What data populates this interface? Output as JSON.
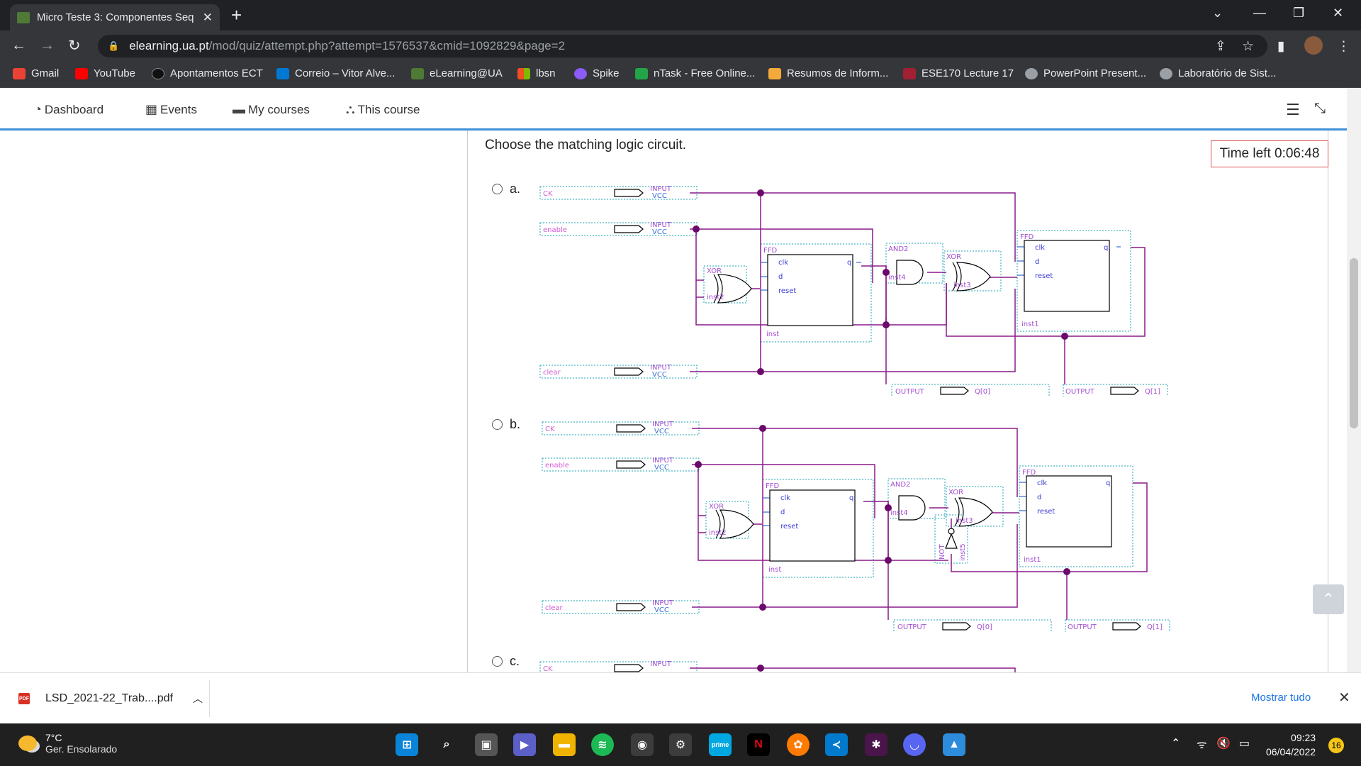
{
  "browser": {
    "tab_title": "Micro Teste 3: Componentes Seq",
    "url_host": "elearning.ua.pt",
    "url_path": "/mod/quiz/attempt.php?attempt=1576537&cmid=1092829&page=2"
  },
  "bookmarks": [
    {
      "label": "Gmail",
      "color": "#ea4335"
    },
    {
      "label": "YouTube",
      "color": "#ff0000"
    },
    {
      "label": "Apontamentos ECT",
      "color": "#111111"
    },
    {
      "label": "Correio – Vitor Alve...",
      "color": "#0078d4"
    },
    {
      "label": "eLearning@UA",
      "color": "#4e7a35"
    },
    {
      "label": "lbsn",
      "color": "#f25022"
    },
    {
      "label": "Spike",
      "color": "#8b5cf6"
    },
    {
      "label": "nTask - Free Online...",
      "color": "#22a447"
    },
    {
      "label": "Resumos de Inform...",
      "color": "#f4a93b"
    },
    {
      "label": "ESE170 Lecture 17",
      "color": "#a31f34"
    },
    {
      "label": "PowerPoint Present...",
      "color": "#9aa0a6"
    },
    {
      "label": "Laboratório de Sist...",
      "color": "#9aa0a6"
    }
  ],
  "moodle_nav": {
    "dashboard": "Dashboard",
    "events": "Events",
    "my_courses": "My courses",
    "this_course": "This course"
  },
  "quiz": {
    "question": "Choose the matching logic circuit.",
    "timer": "Time left 0:06:48",
    "options": [
      "a.",
      "b.",
      "c."
    ]
  },
  "circuit": {
    "inputs": [
      "CK",
      "enable",
      "clear"
    ],
    "input_tag": "INPUT",
    "vcc": "VCC",
    "ffd": "FFD",
    "xor": "XOR",
    "and2": "AND2",
    "not": "NOT",
    "pin_clk": "clk",
    "pin_d": "d",
    "pin_reset": "reset",
    "pin_q": "q",
    "inst": "inst",
    "inst1": "inst1",
    "inst2": "inst2",
    "inst3": "inst3",
    "inst4": "inst4",
    "inst5": "inst5",
    "output_tag": "OUTPUT",
    "q0": "Q[0]",
    "q1": "Q[1]"
  },
  "download": {
    "file": "LSD_2021-22_Trab....pdf",
    "show_all": "Mostrar tudo"
  },
  "taskbar": {
    "temp": "7°C",
    "weather": "Ger. Ensolarado",
    "time": "09:23",
    "date": "06/04/2022",
    "notifications": "16"
  }
}
